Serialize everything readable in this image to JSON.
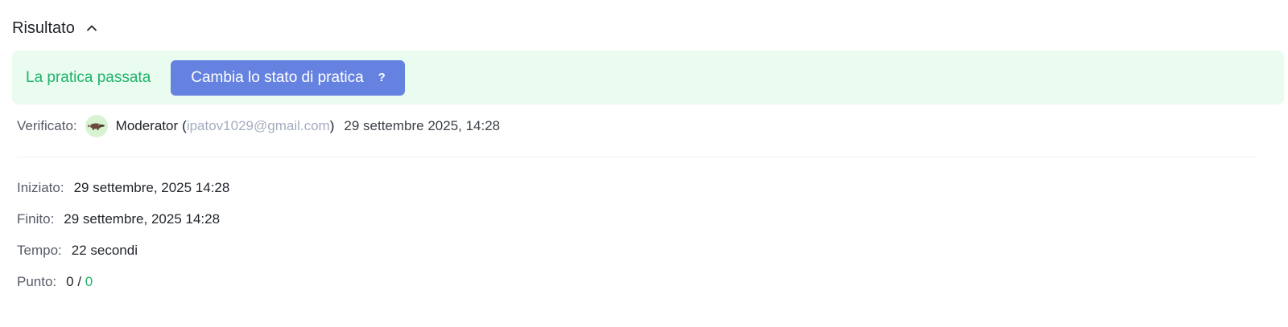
{
  "section": {
    "title": "Risultato",
    "toggle_icon": "chevron-up-icon"
  },
  "result": {
    "status": "La pratica passata",
    "status_color": "#1fb36b",
    "banner_color": "#eafbef",
    "change_button_label": "Cambia lo stato di pratica",
    "help_label": "?",
    "button_color": "#6582e0"
  },
  "verification": {
    "label": "Verificato:",
    "avatar_icon": "platypus-avatar-icon",
    "moderator_name": "Moderator",
    "open_paren": "(",
    "email": "ipatov1029@gmail.com",
    "close_paren": ")",
    "date": "29 settembre 2025, 14:28"
  },
  "details": {
    "started_label": "Iniziato:",
    "started_value": "29 settembre, 2025 14:28",
    "finished_label": "Finito:",
    "finished_value": "29 settembre, 2025 14:28",
    "time_label": "Tempo:",
    "time_value": "22 secondi",
    "score_label": "Punto:",
    "score_value": "0 / ",
    "score_max": "0"
  }
}
